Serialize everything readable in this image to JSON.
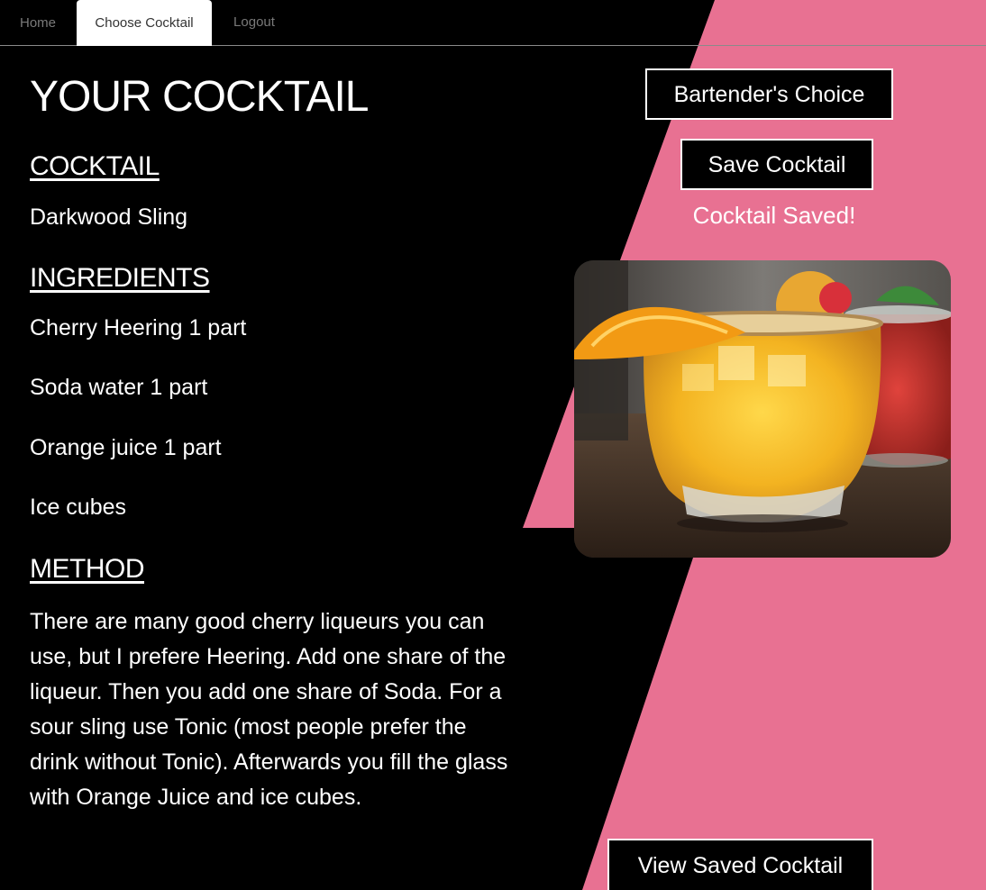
{
  "nav": {
    "home": "Home",
    "choose": "Choose Cocktail",
    "logout": "Logout"
  },
  "page_title": "YOUR COCKTAIL",
  "cocktail": {
    "heading": "COCKTAIL",
    "name": "Darkwood Sling"
  },
  "ingredients": {
    "heading": "INGREDIENTS",
    "items": [
      "Cherry Heering 1 part",
      "Soda water 1 part",
      "Orange juice 1 part",
      "Ice cubes"
    ]
  },
  "method": {
    "heading": "METHOD",
    "text": "There are many good cherry liqueurs you can use, but I prefere Heering. Add one share of the liqueur. Then you add one share of Soda. For a sour sling use Tonic (most people prefer the drink without Tonic). Afterwards you fill the glass with Orange Juice and ice cubes."
  },
  "buttons": {
    "bartender": "Bartender's Choice",
    "save": "Save Cocktail",
    "view_saved": "View Saved Cocktail"
  },
  "status": {
    "saved": "Cocktail Saved!"
  },
  "colors": {
    "background": "#000000",
    "accent_pink": "#e87192",
    "text": "#ffffff"
  }
}
